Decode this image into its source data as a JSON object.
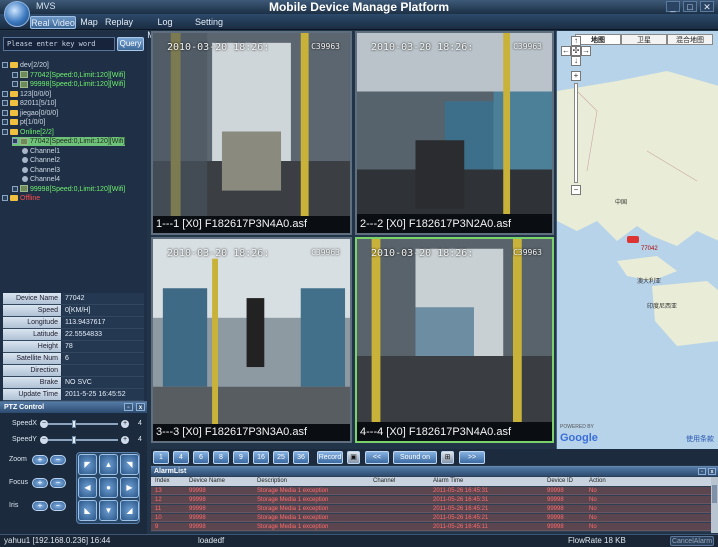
{
  "window": {
    "app_short": "MVS",
    "title": "Mobile Device Manage Platform",
    "min": "_",
    "max": "□",
    "close": "✕"
  },
  "nav": {
    "tabs": [
      {
        "label": "Real Video",
        "active": true
      },
      {
        "label": "Map",
        "active": false
      },
      {
        "label": "Replay",
        "active": false
      },
      {
        "label": "Log Manager",
        "active": false
      },
      {
        "label": "Setting",
        "active": false
      }
    ]
  },
  "search": {
    "placeholder": "Please enter key word",
    "button": "Query"
  },
  "tree": [
    {
      "text": "dev[2/20]",
      "kind": "folder",
      "color": "normal",
      "indent": 0
    },
    {
      "text": "77042[Speed:0,Limit:120][Wifi]",
      "kind": "car",
      "color": "green",
      "indent": 1
    },
    {
      "text": "99998[Speed:0,Limit:120][Wifi]",
      "kind": "car",
      "color": "green",
      "indent": 1
    },
    {
      "text": "123[0/0/0]",
      "kind": "folder",
      "color": "normal",
      "indent": 0
    },
    {
      "text": "82011[5/10]",
      "kind": "folder",
      "color": "normal",
      "indent": 0
    },
    {
      "text": "jiegao[0/0/0]",
      "kind": "folder",
      "color": "normal",
      "indent": 0
    },
    {
      "text": "pt[1/0/0]",
      "kind": "folder",
      "color": "normal",
      "indent": 0
    },
    {
      "text": "Online[2/2]",
      "kind": "folder",
      "color": "green",
      "indent": 0
    },
    {
      "text": "77042[Speed:0,Limit:120][Wifi]",
      "kind": "car",
      "color": "selected",
      "indent": 1
    },
    {
      "text": "Channel1",
      "kind": "cam",
      "color": "normal",
      "indent": 2
    },
    {
      "text": "Channel2",
      "kind": "cam",
      "color": "normal",
      "indent": 2
    },
    {
      "text": "Channel3",
      "kind": "cam",
      "color": "normal",
      "indent": 2
    },
    {
      "text": "Channel4",
      "kind": "cam",
      "color": "normal",
      "indent": 2
    },
    {
      "text": "99998[Speed:0,Limit:120][Wifi]",
      "kind": "car",
      "color": "green",
      "indent": 1
    },
    {
      "text": "Offline",
      "kind": "folder",
      "color": "red",
      "indent": 0
    }
  ],
  "device_info": [
    {
      "label": "Device Name",
      "value": "77042"
    },
    {
      "label": "Speed",
      "value": "0[KM/H]"
    },
    {
      "label": "Longitude",
      "value": "113.9437617"
    },
    {
      "label": "Latitude",
      "value": "22.5554833"
    },
    {
      "label": "Height",
      "value": "78"
    },
    {
      "label": "Satellite Num",
      "value": "6"
    },
    {
      "label": "Direction",
      "value": ""
    },
    {
      "label": "Brake",
      "value": "NO SVC"
    },
    {
      "label": "Update Time",
      "value": "2011-5-25 16:45:52"
    }
  ],
  "ptz": {
    "title": "PTZ Control",
    "speedx_label": "SpeedX",
    "speedx_value": "4",
    "speedy_label": "SpeedY",
    "speedy_value": "4",
    "zoom_label": "Zoom",
    "focus_label": "Focus",
    "iris_label": "Iris"
  },
  "videos": [
    {
      "timestamp": "2010-03-20 18:26:",
      "tag": "C39963",
      "caption": "1---1 [X0] F182617P3N4A0.asf",
      "active": false
    },
    {
      "timestamp": "2010-03-20 18:26:",
      "tag": "C39963",
      "caption": "2---2 [X0] F182617P3N2A0.asf",
      "active": false
    },
    {
      "timestamp": "2010-03-20 18:26:",
      "tag": "C39963",
      "caption": "3---3 [X0] F182617P3N3A0.asf",
      "active": false
    },
    {
      "timestamp": "2010-03-20 18:26:",
      "tag": "C39963",
      "caption": "4---4 [X0] F182617P3N4A0.asf",
      "active": true
    }
  ],
  "map": {
    "tabs": [
      "地图",
      "卫星",
      "混合地图"
    ],
    "labels": [
      "中国",
      "77042",
      "澳大利亚",
      "印度尼西亚"
    ],
    "powered_by": "POWERED BY",
    "google": "Google",
    "link": "使用条款"
  },
  "toolbar": {
    "buttons": [
      "1",
      "4",
      "6",
      "8",
      "9",
      "16",
      "25",
      "36"
    ],
    "record": "Record",
    "snapshot": "▣",
    "prev": "<<",
    "sound": "Sound on",
    "grid": "⊞",
    "next": ">>"
  },
  "alarm": {
    "title": "AlarmList",
    "columns": [
      "Index",
      "Device Name",
      "Description",
      "Channel",
      "Alarm Time",
      "Device ID",
      "Action"
    ],
    "rows": [
      {
        "index": "13",
        "device": "99998",
        "desc": "Storage Media 1 exception",
        "channel": "",
        "time": "2011-05-26 16:45:31",
        "id": "99998",
        "action": "No"
      },
      {
        "index": "12",
        "device": "99998",
        "desc": "Storage Media 1 exception",
        "channel": "",
        "time": "2011-05-26 16:45:31",
        "id": "99998",
        "action": "No"
      },
      {
        "index": "11",
        "device": "99998",
        "desc": "Storage Media 1 exception",
        "channel": "",
        "time": "2011-05-26 16:45:21",
        "id": "99998",
        "action": "No"
      },
      {
        "index": "10",
        "device": "99998",
        "desc": "Storage Media 1 exception",
        "channel": "",
        "time": "2011-05-26 16:45:21",
        "id": "99998",
        "action": "No"
      },
      {
        "index": "9",
        "device": "99998",
        "desc": "Storage Media 1 exception",
        "channel": "",
        "time": "2011-05-26 16:45:11",
        "id": "99998",
        "action": "No"
      }
    ]
  },
  "status": {
    "user": "yahuu1 [192.168.0.236]  16:44",
    "loaded": "loadedf",
    "flowrate": "FlowRate 18 KB",
    "cancel": "CancelAlarm"
  }
}
